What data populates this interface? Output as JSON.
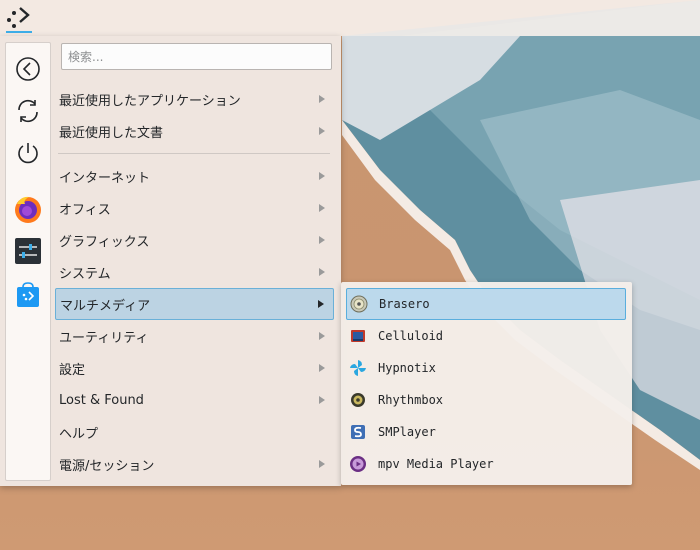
{
  "search": {
    "placeholder": "検索..."
  },
  "favorites": [
    {
      "icon": "back-arrow-icon"
    },
    {
      "icon": "refresh-icon"
    },
    {
      "icon": "power-icon"
    },
    {
      "icon": "firefox-icon"
    },
    {
      "icon": "settings-sliders-icon"
    },
    {
      "icon": "software-store-icon"
    }
  ],
  "categories": [
    {
      "label": "最近使用したアプリケーション",
      "has_submenu": true
    },
    {
      "label": "最近使用した文書",
      "has_submenu": true
    },
    {
      "label": "インターネット",
      "has_submenu": true
    },
    {
      "label": "オフィス",
      "has_submenu": true
    },
    {
      "label": "グラフィックス",
      "has_submenu": true
    },
    {
      "label": "システム",
      "has_submenu": true
    },
    {
      "label": "マルチメディア",
      "has_submenu": true,
      "active": true
    },
    {
      "label": "ユーティリティ",
      "has_submenu": true
    },
    {
      "label": "設定",
      "has_submenu": true
    },
    {
      "label": "Lost & Found",
      "has_submenu": true
    },
    {
      "label": "ヘルプ",
      "has_submenu": false
    },
    {
      "label": "電源/セッション",
      "has_submenu": true
    }
  ],
  "submenu": {
    "items": [
      {
        "label": "Brasero",
        "icon": "brasero-disc-icon",
        "active": true
      },
      {
        "label": "Celluloid",
        "icon": "celluloid-icon"
      },
      {
        "label": "Hypnotix",
        "icon": "hypnotix-icon"
      },
      {
        "label": "Rhythmbox",
        "icon": "rhythmbox-speaker-icon"
      },
      {
        "label": "SMPlayer",
        "icon": "smplayer-icon"
      },
      {
        "label": "mpv Media Player",
        "icon": "mpv-icon"
      }
    ]
  },
  "colors": {
    "accent": "#3daee9",
    "highlight": "#bcd3e3"
  }
}
